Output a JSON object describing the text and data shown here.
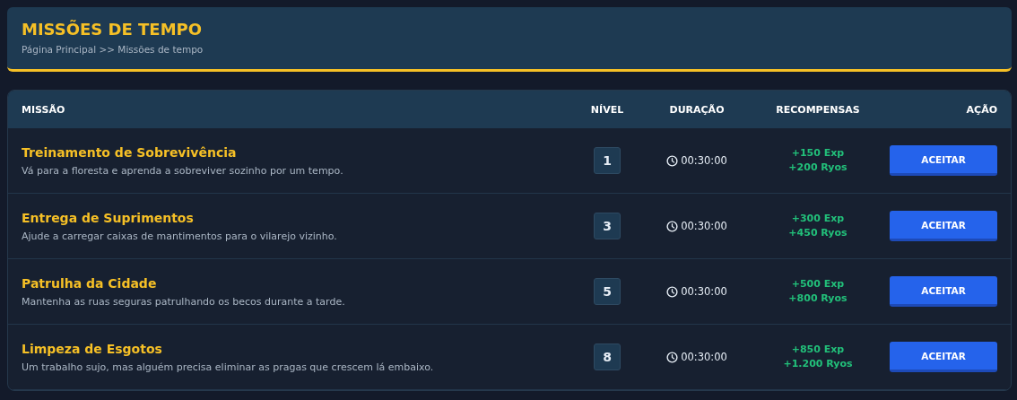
{
  "header": {
    "title": "MISSÕES DE TEMPO",
    "breadcrumb": "Página Principal >> Missões de tempo"
  },
  "table": {
    "columns": [
      "MISSÃO",
      "NÍVEL",
      "DURAÇÃO",
      "RECOMPENSAS",
      "AÇÃO"
    ],
    "rows": [
      {
        "title": "Treinamento de Sobrevivência",
        "description": "Vá para a floresta e aprenda a sobreviver sozinho por um tempo.",
        "level": "1",
        "duration": "00:30:00",
        "rewards": [
          "+150 Exp",
          "+200 Ryos"
        ],
        "action": "ACEITAR"
      },
      {
        "title": "Entrega de Suprimentos",
        "description": "Ajude a carregar caixas de mantimentos para o vilarejo vizinho.",
        "level": "3",
        "duration": "00:30:00",
        "rewards": [
          "+300 Exp",
          "+450 Ryos"
        ],
        "action": "ACEITAR"
      },
      {
        "title": "Patrulha da Cidade",
        "description": "Mantenha as ruas seguras patrulhando os becos durante a tarde.",
        "level": "5",
        "duration": "00:30:00",
        "rewards": [
          "+500 Exp",
          "+800 Ryos"
        ],
        "action": "ACEITAR"
      },
      {
        "title": "Limpeza de Esgotos",
        "description": "Um trabalho sujo, mas alguém precisa eliminar as pragas que crescem lá embaixo.",
        "level": "8",
        "duration": "00:30:00",
        "rewards": [
          "+850 Exp",
          "+1.200 Ryos"
        ],
        "action": "ACEITAR"
      }
    ]
  }
}
